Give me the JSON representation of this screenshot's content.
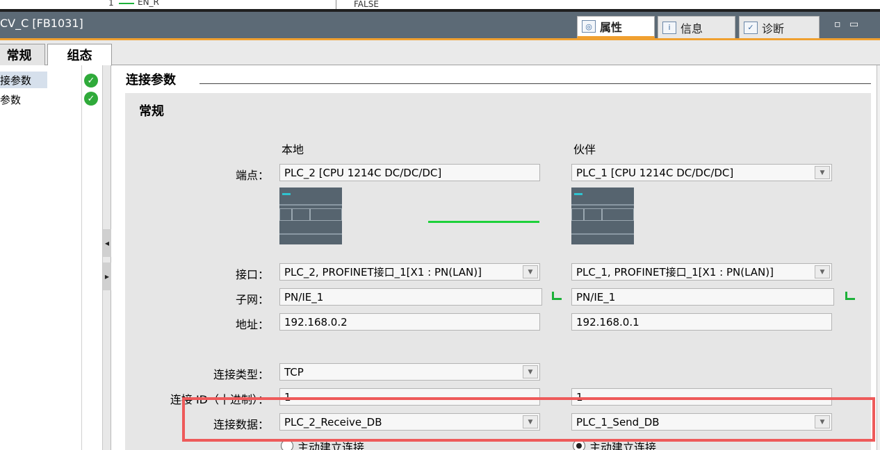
{
  "top_strip": {
    "line_no": "1",
    "en_label": "EN_R",
    "false_label": "FALSE"
  },
  "title_bar": {
    "title": "CV_C [FB1031]",
    "tabs": [
      {
        "label": "属性",
        "icon": "properties-icon",
        "active": true
      },
      {
        "label": "信息",
        "icon": "info-icon",
        "active": false
      },
      {
        "label": "诊断",
        "icon": "diagnostics-icon",
        "active": false
      }
    ],
    "window_controls": "▫ ▭"
  },
  "sub_tabs": {
    "general": "常规",
    "config": "组态"
  },
  "left_nav": {
    "items": [
      {
        "label": "连接参数",
        "status": "ok",
        "selected": true
      },
      {
        "label": "块参数",
        "status": "ok",
        "selected": false
      }
    ]
  },
  "main": {
    "section_title": "连接参数",
    "group_title": "常规",
    "col_local": "本地",
    "col_partner": "伙伴",
    "labels": {
      "endpoint": "端点：",
      "interface": "接口：",
      "subnet": "子网：",
      "address": "地址：",
      "conn_type": "连接类型：",
      "conn_id": "连接 ID（十进制）：",
      "conn_data": "连接数据："
    },
    "local": {
      "endpoint": "PLC_2 [CPU 1214C DC/DC/DC]",
      "interface": "PLC_2, PROFINET接口_1[X1 : PN(LAN)]",
      "subnet": "PN/IE_1",
      "address": "192.168.0.2",
      "conn_type": "TCP",
      "conn_id": "1",
      "conn_data": "PLC_2_Receive_DB",
      "establish": "主动建立连接",
      "establish_checked": false
    },
    "partner": {
      "endpoint": "PLC_1 [CPU 1214C DC/DC/DC]",
      "interface": "PLC_1, PROFINET接口_1[X1 : PN(LAN)]",
      "subnet": "PN/IE_1",
      "address": "192.168.0.1",
      "conn_id": "1",
      "conn_data": "PLC_1_Send_DB",
      "establish": "主动建立连接",
      "establish_checked": true
    }
  },
  "colors": {
    "title_bar": "#5c6a76",
    "accent": "#f0a030",
    "highlight": "#ee5a5a",
    "link_green": "#1dd13a"
  }
}
